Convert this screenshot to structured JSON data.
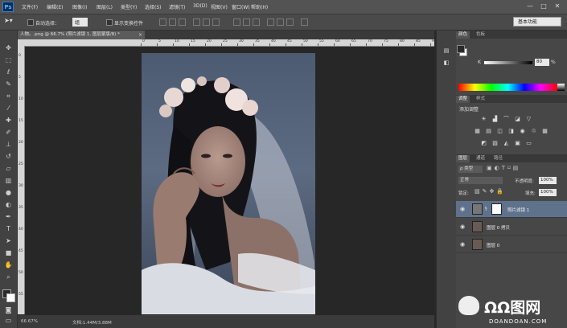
{
  "app": {
    "logo": "Ps"
  },
  "menu": [
    "文件(F)",
    "编辑(E)",
    "图像(I)",
    "图层(L)",
    "类型(Y)",
    "选择(S)",
    "滤镜(T)",
    "3D(D)",
    "视图(V)",
    "窗口(W)",
    "帮助(H)"
  ],
  "window_controls": {
    "minimize": "—",
    "maximize": "□",
    "close": "✕"
  },
  "options": {
    "auto_select_label": "自动选择：",
    "auto_select_value": "组",
    "show_transform_label": "显示变换控件",
    "workspace": "基本功能"
  },
  "document": {
    "tab_title": "人物。.png @ 66.7% (照片滤镜 1, 图层蒙版/8) *",
    "tab_close": "×",
    "zoom": "66.67%",
    "doc_size": "文档:1.44M/3.88M"
  },
  "tools": [
    "move-icon",
    "marquee-icon",
    "lasso-icon",
    "quick-select-icon",
    "crop-icon",
    "eyedropper-icon",
    "healing-icon",
    "brush-icon",
    "clone-stamp-icon",
    "history-brush-icon",
    "eraser-icon",
    "gradient-icon",
    "blur-icon",
    "dodge-icon",
    "pen-icon",
    "type-icon",
    "path-select-icon",
    "shape-icon",
    "hand-icon",
    "zoom-icon"
  ],
  "ruler_top": [
    "0",
    "5",
    "10",
    "15",
    "20",
    "25",
    "30",
    "35",
    "40",
    "45",
    "50",
    "55",
    "60",
    "65",
    "70",
    "75",
    "80",
    "85",
    "90"
  ],
  "ruler_left": [
    "0",
    "5",
    "10",
    "15",
    "20",
    "25",
    "30",
    "35",
    "40",
    "45",
    "50",
    "55"
  ],
  "panels": {
    "color": {
      "tabs": [
        "颜色",
        "色板"
      ],
      "channel": "K",
      "value": "80",
      "unit": "%",
      "fg_color": "#2a2a2a",
      "bg_color": "#ffffff"
    },
    "adjustments": {
      "tabs": [
        "调整",
        "样式"
      ],
      "title": "添加调整",
      "icons_row1": [
        "brightness-icon",
        "levels-icon",
        "curves-icon",
        "exposure-icon",
        "gradient-triangle-icon"
      ],
      "icons_row2": [
        "vibrance-icon",
        "hue-sat-icon",
        "color-balance-icon",
        "bw-icon",
        "photo-filter-icon",
        "channel-mixer-icon",
        "color-lookup-icon"
      ],
      "icons_row3": [
        "invert-icon",
        "posterize-icon",
        "threshold-icon",
        "selective-color-icon",
        "gradient-map-icon"
      ]
    },
    "layers": {
      "tabs": [
        "图层",
        "通道",
        "路径"
      ],
      "filter_label": "ρ 类型",
      "blend_mode": "正常",
      "opacity_label": "不透明度:",
      "opacity": "100%",
      "lock_label": "锁定:",
      "fill_label": "填充:",
      "fill": "100%",
      "items": [
        {
          "name": "照片滤镜 1",
          "selected": true
        },
        {
          "name": "图层 0 拷贝",
          "selected": false
        },
        {
          "name": "图层 0",
          "selected": false
        }
      ]
    }
  },
  "watermark": {
    "brand": "ΩΩ图网",
    "url": "DOANDOAN.COM"
  }
}
